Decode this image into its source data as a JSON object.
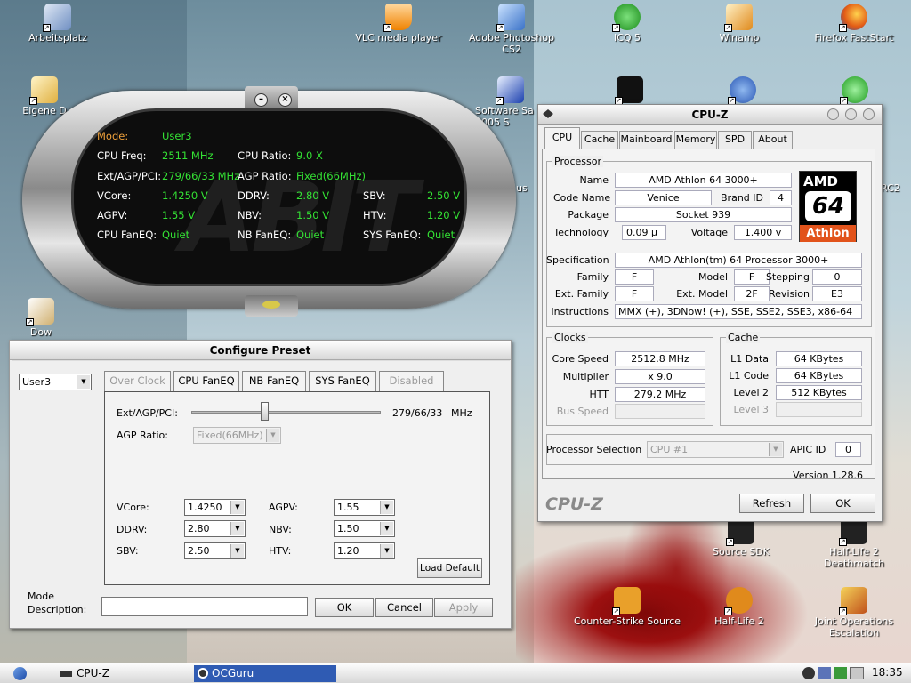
{
  "desktop_icons": [
    {
      "label": "Arbeitsplatz",
      "icon": "my-computer-icon"
    },
    {
      "label": "VLC media player",
      "icon": "vlc-icon"
    },
    {
      "label": "Adobe Photoshop CS2",
      "icon": "photoshop-icon"
    },
    {
      "label": "ICQ 5",
      "icon": "icq-icon"
    },
    {
      "label": "Winamp",
      "icon": "winamp-icon"
    },
    {
      "label": "Firefox FastStart",
      "icon": "firefox-icon"
    },
    {
      "label": "Eigene D",
      "icon": "my-documents-icon"
    },
    {
      "label": "Software Sa 2005 S",
      "icon": "software-icon"
    },
    {
      "label": "Dow",
      "icon": "downloads-icon"
    },
    {
      "label": "Source SDK",
      "icon": "source-sdk-icon"
    },
    {
      "label": "Half-Life 2 Deathmatch",
      "icon": "hl2dm-icon"
    },
    {
      "label": "Counter-Strike Source",
      "icon": "css-icon"
    },
    {
      "label": "Half-Life 2",
      "icon": "hl2-icon"
    },
    {
      "label": "Joint Operations Escalation",
      "icon": "jo-icon"
    },
    {
      "label": "us",
      "icon": "generic-icon"
    },
    {
      "label": "RC2",
      "icon": "generic-icon"
    }
  ],
  "abit": {
    "logo": "ABIT",
    "mode_label": "Mode:",
    "mode_value": "User3",
    "cpufreq_label": "CPU Freq:",
    "cpufreq_value": "2511 MHz",
    "cpuratio_label": "CPU Ratio:",
    "cpuratio_value": "9.0 X",
    "ext_label": "Ext/AGP/PCI:",
    "ext_value": "279/66/33 MHz",
    "agpratio_label": "AGP Ratio:",
    "agpratio_value": "Fixed(66MHz)",
    "vcore_label": "VCore:",
    "vcore_value": "1.4250 V",
    "ddrv_label": "DDRV:",
    "ddrv_value": "2.80 V",
    "sbv_label": "SBV:",
    "sbv_value": "2.50 V",
    "agpv_label": "AGPV:",
    "agpv_value": "1.55 V",
    "nbv_label": "NBV:",
    "nbv_value": "1.50 V",
    "htv_label": "HTV:",
    "htv_value": "1.20 V",
    "cpufan_label": "CPU FanEQ:",
    "cpufan_value": "Quiet",
    "nbfan_label": "NB FanEQ:",
    "nbfan_value": "Quiet",
    "sysfan_label": "SYS FanEQ:",
    "sysfan_value": "Quiet"
  },
  "config": {
    "title": "Configure Preset",
    "preset": "User3",
    "tabs": [
      "Over Clock",
      "CPU FanEQ",
      "NB FanEQ",
      "SYS FanEQ",
      "Disabled"
    ],
    "ext_label": "Ext/AGP/PCI:",
    "ext_value": "279/66/33",
    "ext_unit": "MHz",
    "agp_label": "AGP Ratio:",
    "agp_value": "Fixed(66MHz)",
    "vcore_label": "VCore:",
    "vcore_value": "1.4250",
    "agpv_label": "AGPV:",
    "agpv_value": "1.55",
    "ddrv_label": "DDRV:",
    "ddrv_value": "2.80",
    "nbv_label": "NBV:",
    "nbv_value": "1.50",
    "sbv_label": "SBV:",
    "sbv_value": "2.50",
    "htv_label": "HTV:",
    "htv_value": "1.20",
    "load_default": "Load Default",
    "mode_desc_label1": "Mode",
    "mode_desc_label2": "Description:",
    "ok": "OK",
    "cancel": "Cancel",
    "apply": "Apply"
  },
  "cpuz": {
    "title": "CPU-Z",
    "tabs": [
      "CPU",
      "Cache",
      "Mainboard",
      "Memory",
      "SPD",
      "About"
    ],
    "processor_group": "Processor",
    "name_label": "Name",
    "name": "AMD Athlon 64 3000+",
    "codename_label": "Code Name",
    "codename": "Venice",
    "brandid_label": "Brand ID",
    "brandid": "4",
    "package_label": "Package",
    "package": "Socket 939",
    "technology_label": "Technology",
    "technology": "0.09 µ",
    "voltage_label": "Voltage",
    "voltage": "1.400 v",
    "spec_label": "Specification",
    "spec": "AMD Athlon(tm) 64 Processor 3000+",
    "family_label": "Family",
    "family": "F",
    "model_label": "Model",
    "model": "F",
    "stepping_label": "Stepping",
    "stepping": "0",
    "extfamily_label": "Ext. Family",
    "extfamily": "F",
    "extmodel_label": "Ext. Model",
    "extmodel": "2F",
    "revision_label": "Revision",
    "revision": "E3",
    "instructions_label": "Instructions",
    "instructions": "MMX (+), 3DNow! (+), SSE, SSE2, SSE3, x86-64",
    "logo_top": "AMD",
    "logo_mid": "64",
    "logo_bottom": "Athlon",
    "clocks_group": "Clocks",
    "corespeed_label": "Core Speed",
    "corespeed": "2512.8 MHz",
    "multiplier_label": "Multiplier",
    "multiplier": "x 9.0",
    "htt_label": "HTT",
    "htt": "279.2 MHz",
    "busspeed_label": "Bus Speed",
    "busspeed": "",
    "cache_group": "Cache",
    "l1data_label": "L1 Data",
    "l1data": "64 KBytes",
    "l1code_label": "L1 Code",
    "l1code": "64 KBytes",
    "level2_label": "Level 2",
    "level2": "512 KBytes",
    "level3_label": "Level 3",
    "level3": "",
    "procsel_label": "Processor Selection",
    "procsel": "CPU #1",
    "apicid_label": "APIC ID",
    "apicid": "0",
    "version": "Version 1.28.6",
    "footer_logo": "CPU-Z",
    "refresh": "Refresh",
    "ok": "OK"
  },
  "taskbar": {
    "items": [
      "CPU-Z",
      "OCGuru"
    ],
    "clock": "18:35"
  }
}
